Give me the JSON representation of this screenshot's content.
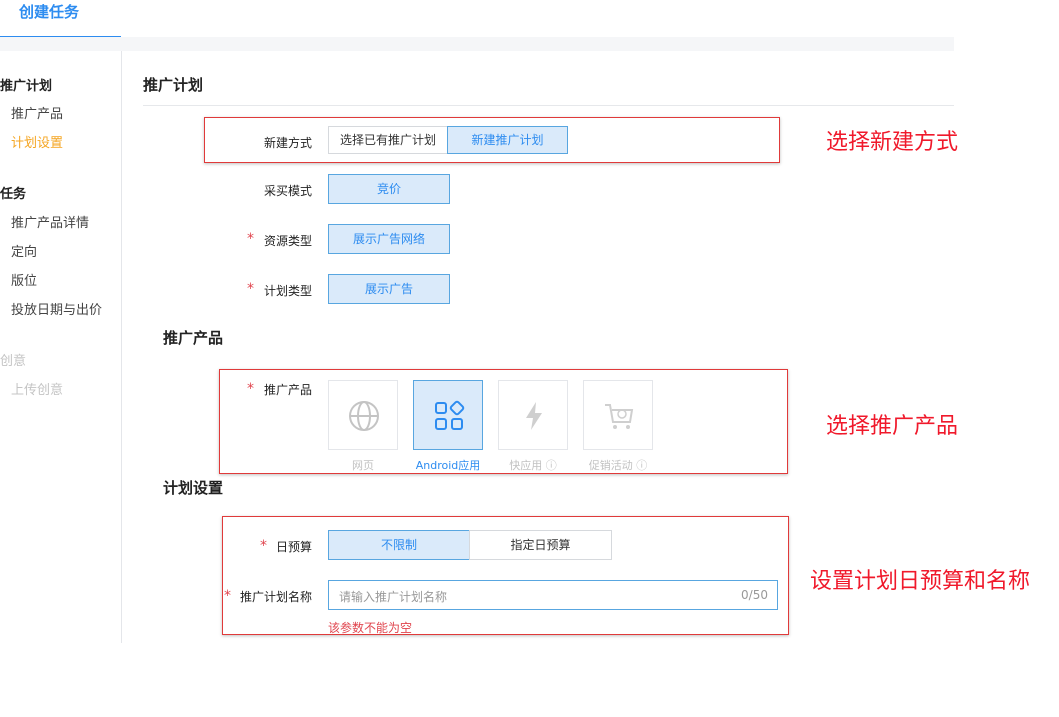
{
  "header": {
    "tab_label": "创建任务"
  },
  "sidebar": {
    "group1": {
      "title": "推广计划",
      "items": [
        "推广产品",
        "计划设置"
      ]
    },
    "group2": {
      "title": "任务",
      "items": [
        "推广产品详情",
        "定向",
        "版位",
        "投放日期与出价"
      ]
    },
    "group3": {
      "title": "创意",
      "items": [
        "上传创意"
      ]
    }
  },
  "main": {
    "section_title": "推广计划",
    "plan": {
      "new_mode_label": "新建方式",
      "new_mode_options": [
        "选择已有推广计划",
        "新建推广计划"
      ],
      "new_mode_selected": "新建推广计划",
      "purchase_label": "采买模式",
      "purchase_value": "竞价",
      "resource_label": "资源类型",
      "resource_value": "展示广告网络",
      "plan_type_label": "计划类型",
      "plan_type_value": "展示广告"
    },
    "product_section_title": "推广产品",
    "product": {
      "label": "推广产品",
      "options": [
        {
          "label": "网页",
          "icon": "globe-icon"
        },
        {
          "label": "Android应用",
          "icon": "app-grid-icon"
        },
        {
          "label": "快应用 ⓘ",
          "icon": "lightning-icon"
        },
        {
          "label": "促销活动 ⓘ",
          "icon": "shopping-cart-icon"
        }
      ],
      "selected": "Android应用"
    },
    "settings_section_title": "计划设置",
    "settings": {
      "budget_label": "日预算",
      "budget_options": [
        "不限制",
        "指定日预算"
      ],
      "budget_selected": "不限制",
      "name_label": "推广计划名称",
      "name_placeholder": "请输入推广计划名称",
      "name_counter": "0/50",
      "name_error": "该参数不能为空"
    },
    "required_mark": "*"
  },
  "annotations": {
    "a1": "选择新建方式",
    "a2": "选择推广产品",
    "a3": "设置计划日预算和名称"
  },
  "colors": {
    "accent": "#2d8cf0",
    "annotation": "#f0192b",
    "active_menu": "#f5a623",
    "error": "#e0454e"
  }
}
